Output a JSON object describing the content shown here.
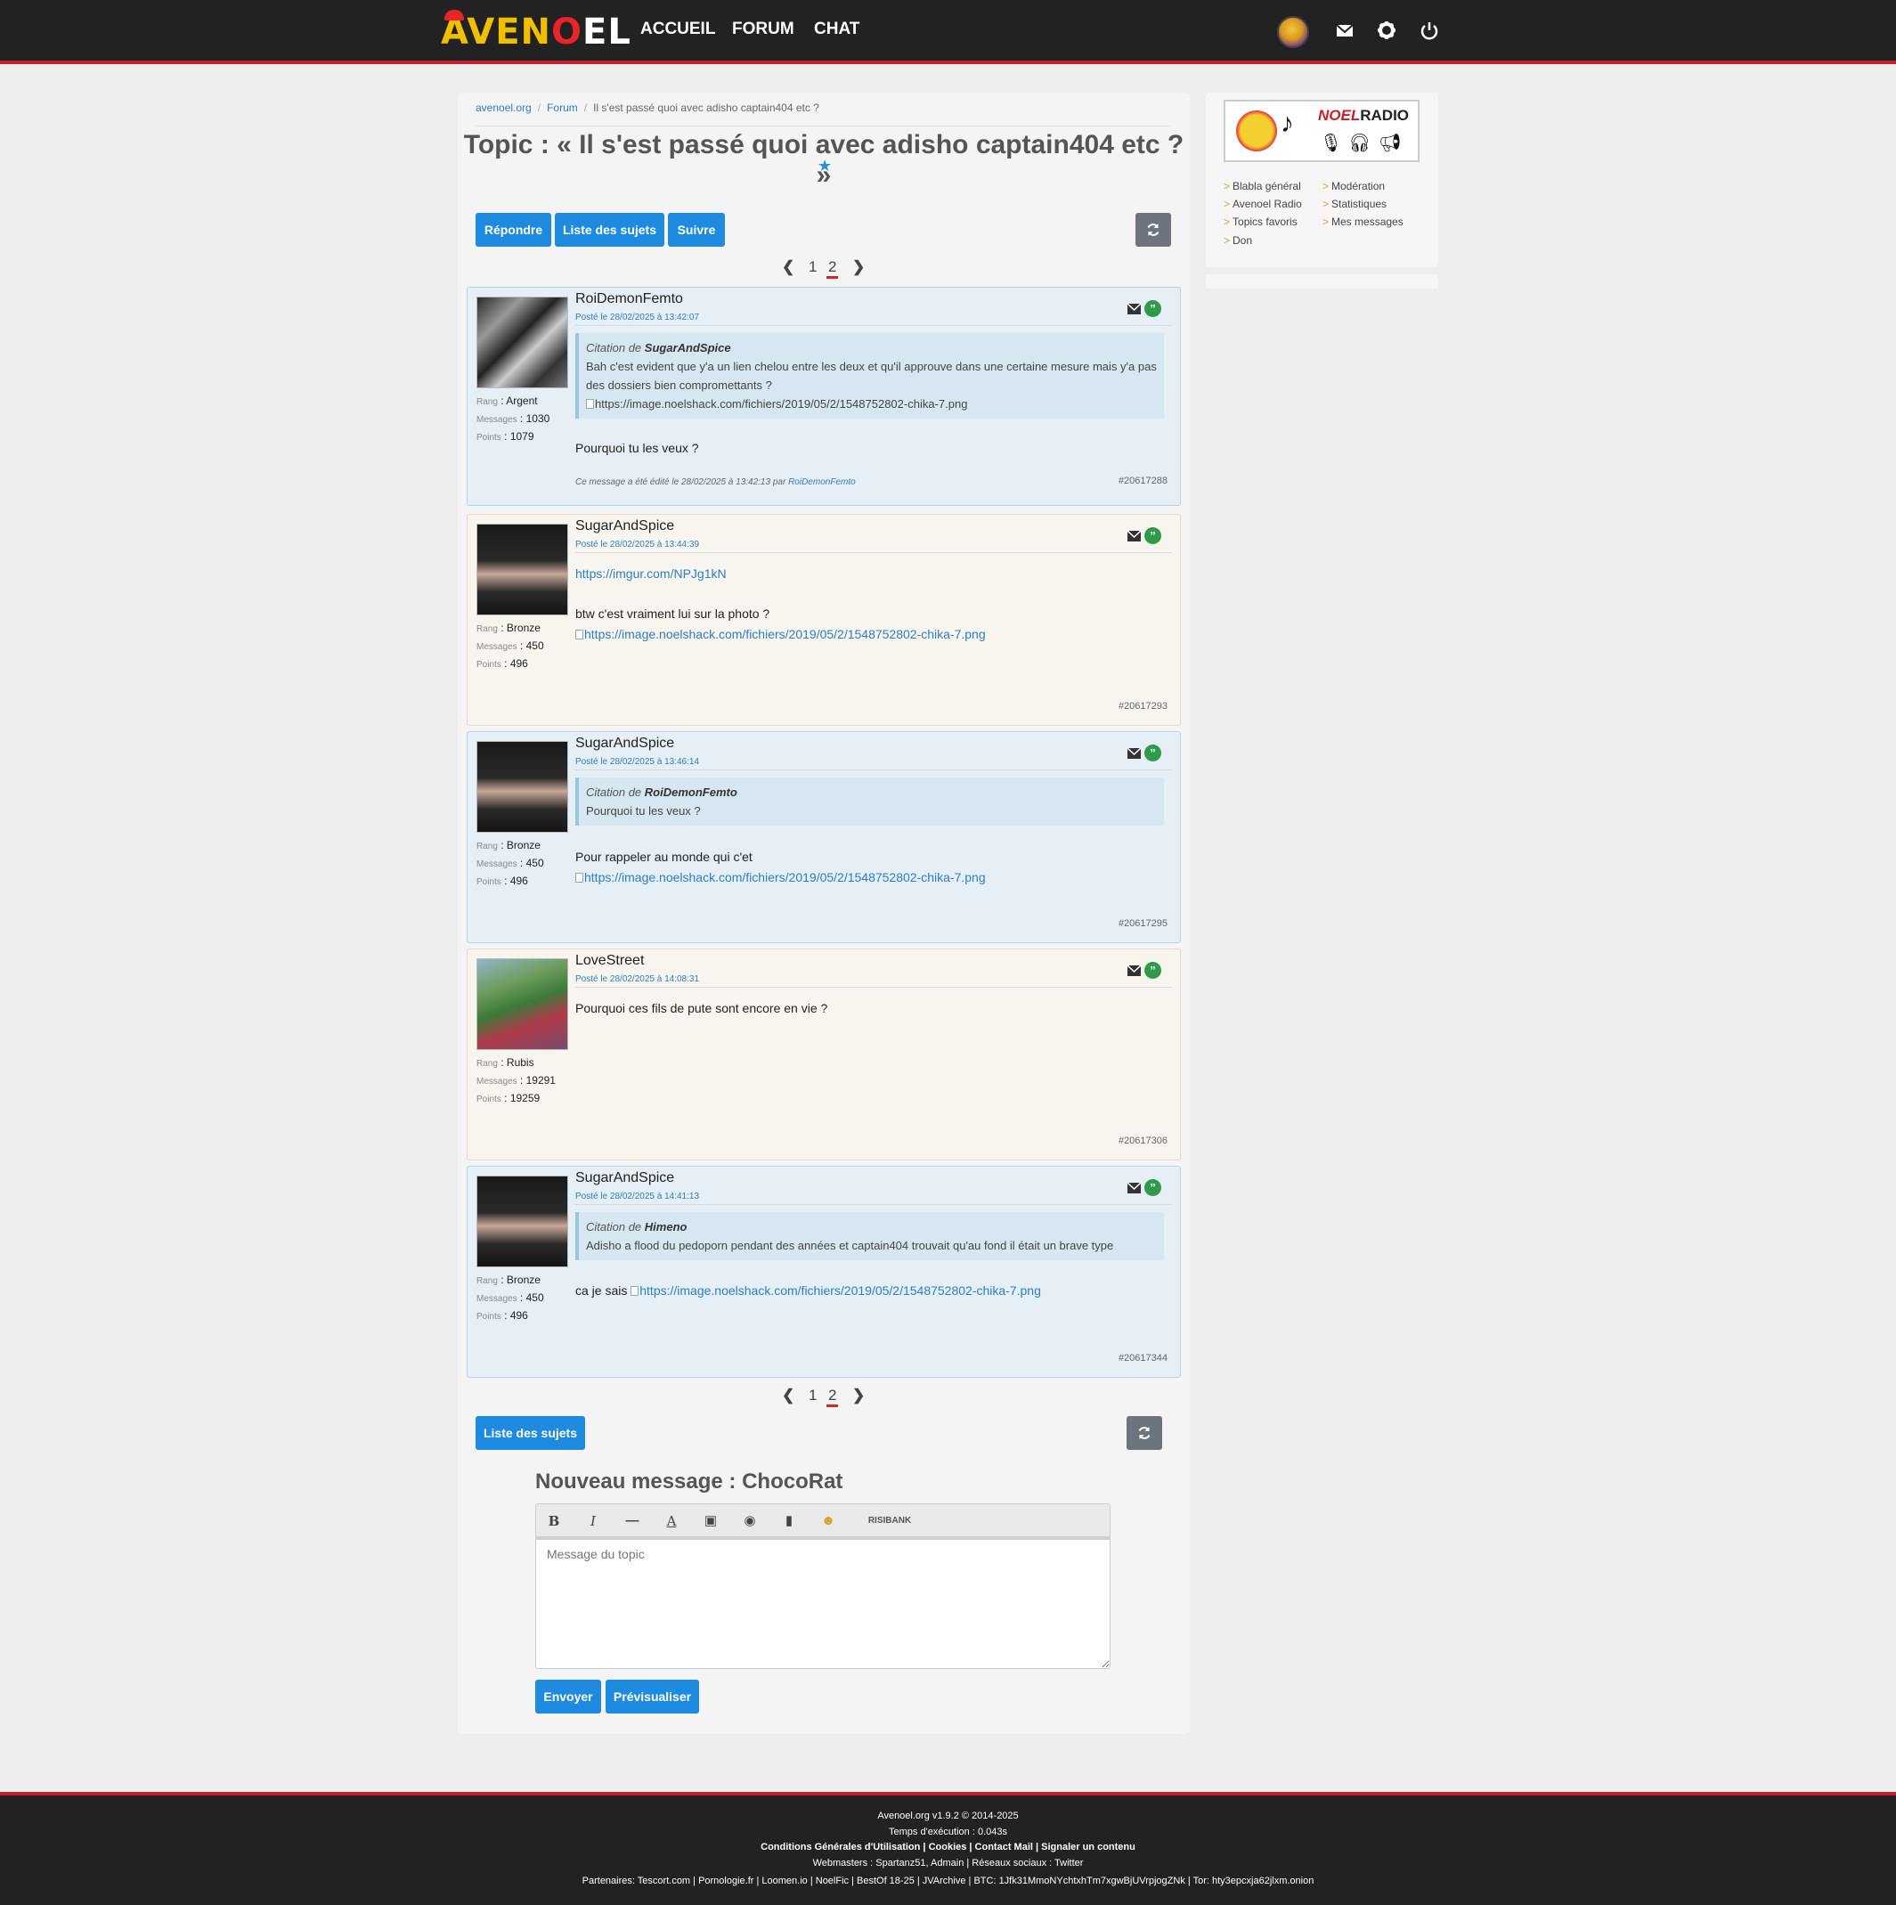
{
  "nav": {
    "logo": "AVENOEL",
    "accueil": "ACCUEIL",
    "forum": "FORUM",
    "chat": "CHAT"
  },
  "breadcrumb": {
    "home": "avenoel.org",
    "forum": "Forum",
    "current": "Il s'est passé quoi avec adisho captain404 etc ?"
  },
  "topic": {
    "title": "Topic : « Il s'est passé quoi avec adisho captain404 etc ? »"
  },
  "buttons": {
    "reply": "Répondre",
    "list": "Liste des sujets",
    "follow": "Suivre",
    "list_bottom": "Liste des sujets",
    "send": "Envoyer",
    "preview": "Prévisualiser"
  },
  "pagination": {
    "page1": "1",
    "page2": "2"
  },
  "posts": [
    {
      "author": "RoiDemonFemto",
      "date": "Posté le 28/02/2025 à 13:42:07",
      "rang": "Argent",
      "messages": "1030",
      "points": "1079",
      "quote_author": "SugarAndSpice",
      "quote_text": "Bah c'est evident que y'a un lien chelou entre les deux et qu'il approuve dans une certaine mesure mais y'a pas des dossiers bien compromettants ?",
      "quote_img": "https://image.noelshack.com/fichiers/2019/05/2/1548752802-chika-7.png",
      "body": "Pourquoi tu les veux ?",
      "edited": "Ce message a été édité le 28/02/2025 à 13:42:13 par",
      "edited_by": "RoiDemonFemto",
      "id": "#20617288"
    },
    {
      "author": "SugarAndSpice",
      "date": "Posté le 28/02/2025 à 13:44:39",
      "rang": "Bronze",
      "messages": "450",
      "points": "496",
      "link": "https://imgur.com/NPJg1kN",
      "body": "btw c'est vraiment lui sur la photo ?",
      "img": "https://image.noelshack.com/fichiers/2019/05/2/1548752802-chika-7.png",
      "id": "#20617293"
    },
    {
      "author": "SugarAndSpice",
      "date": "Posté le 28/02/2025 à 13:46:14",
      "rang": "Bronze",
      "messages": "450",
      "points": "496",
      "quote_author": "RoiDemonFemto",
      "quote_text": "Pourquoi tu les veux ?",
      "body": "Pour rappeler au monde qui c'et",
      "img": "https://image.noelshack.com/fichiers/2019/05/2/1548752802-chika-7.png",
      "id": "#20617295"
    },
    {
      "author": "LoveStreet",
      "date": "Posté le 28/02/2025 à 14:08:31",
      "rang": "Rubis",
      "messages": "19291",
      "points": "19259",
      "body": "Pourquoi ces fils de pute sont encore en vie ?",
      "id": "#20617306"
    },
    {
      "author": "SugarAndSpice",
      "date": "Posté le 28/02/2025 à 14:41:13",
      "rang": "Bronze",
      "messages": "450",
      "points": "496",
      "quote_author": "Himeno",
      "quote_text": "Adisho a flood du pedoporn pendant des années et captain404 trouvait qu'au fond il était un brave type",
      "body": "ca je sais",
      "img": "https://image.noelshack.com/fichiers/2019/05/2/1548752802-chika-7.png",
      "id": "#20617344"
    }
  ],
  "labels": {
    "rang": "Rang",
    "messages": "Messages",
    "points": "Points",
    "citation": "Citation de"
  },
  "editor": {
    "title": "Nouveau message : ChocoRat",
    "placeholder": "Message du topic",
    "risibank": "RISIBANK"
  },
  "sidebar": {
    "radio_title_a": "NOEL",
    "radio_title_b": "RADIO",
    "links": [
      "Blabla général",
      "Modération",
      "Avenoel Radio",
      "Statistiques",
      "Topics favoris",
      "Mes messages",
      "Don"
    ]
  },
  "footer": {
    "line1": "Avenoel.org v1.9.2 © 2014-2025",
    "line2": "Temps d'exécution : 0.043s",
    "line3": "Conditions Générales d'Utilisation | Cookies | Contact Mail | Signaler un contenu",
    "line4": "Webmasters : Spartanz51, Admain | Réseaux sociaux : Twitter",
    "line5": "Partenaires: Tescort.com | Pornologie.fr | Loomen.io | NoelFic | BestOf 18-25 | JVArchive | BTC: 1Jfk31MmoNYchtxhTm7xgwBjUVrpjogZNk | Tor: hty3epcxja62jlxm.onion"
  },
  "colors": {
    "nav_bg": "#222222",
    "accent_red": "#c8202a",
    "primary_blue": "#1e8ae0",
    "post_blue": "#e6eff5",
    "post_beige": "#f8f5ee"
  }
}
